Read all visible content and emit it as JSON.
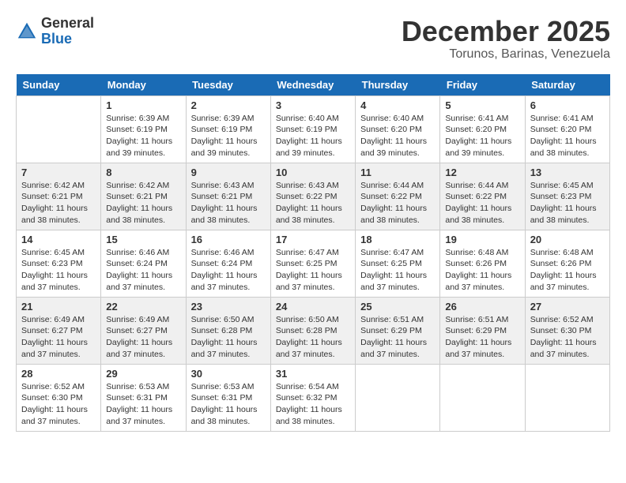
{
  "logo": {
    "general": "General",
    "blue": "Blue"
  },
  "title": {
    "month": "December 2025",
    "location": "Torunos, Barinas, Venezuela"
  },
  "days_header": [
    "Sunday",
    "Monday",
    "Tuesday",
    "Wednesday",
    "Thursday",
    "Friday",
    "Saturday"
  ],
  "weeks": [
    [
      {
        "day": "",
        "info": ""
      },
      {
        "day": "1",
        "info": "Sunrise: 6:39 AM\nSunset: 6:19 PM\nDaylight: 11 hours\nand 39 minutes."
      },
      {
        "day": "2",
        "info": "Sunrise: 6:39 AM\nSunset: 6:19 PM\nDaylight: 11 hours\nand 39 minutes."
      },
      {
        "day": "3",
        "info": "Sunrise: 6:40 AM\nSunset: 6:19 PM\nDaylight: 11 hours\nand 39 minutes."
      },
      {
        "day": "4",
        "info": "Sunrise: 6:40 AM\nSunset: 6:20 PM\nDaylight: 11 hours\nand 39 minutes."
      },
      {
        "day": "5",
        "info": "Sunrise: 6:41 AM\nSunset: 6:20 PM\nDaylight: 11 hours\nand 39 minutes."
      },
      {
        "day": "6",
        "info": "Sunrise: 6:41 AM\nSunset: 6:20 PM\nDaylight: 11 hours\nand 38 minutes."
      }
    ],
    [
      {
        "day": "7",
        "info": "Sunrise: 6:42 AM\nSunset: 6:21 PM\nDaylight: 11 hours\nand 38 minutes."
      },
      {
        "day": "8",
        "info": "Sunrise: 6:42 AM\nSunset: 6:21 PM\nDaylight: 11 hours\nand 38 minutes."
      },
      {
        "day": "9",
        "info": "Sunrise: 6:43 AM\nSunset: 6:21 PM\nDaylight: 11 hours\nand 38 minutes."
      },
      {
        "day": "10",
        "info": "Sunrise: 6:43 AM\nSunset: 6:22 PM\nDaylight: 11 hours\nand 38 minutes."
      },
      {
        "day": "11",
        "info": "Sunrise: 6:44 AM\nSunset: 6:22 PM\nDaylight: 11 hours\nand 38 minutes."
      },
      {
        "day": "12",
        "info": "Sunrise: 6:44 AM\nSunset: 6:22 PM\nDaylight: 11 hours\nand 38 minutes."
      },
      {
        "day": "13",
        "info": "Sunrise: 6:45 AM\nSunset: 6:23 PM\nDaylight: 11 hours\nand 38 minutes."
      }
    ],
    [
      {
        "day": "14",
        "info": "Sunrise: 6:45 AM\nSunset: 6:23 PM\nDaylight: 11 hours\nand 37 minutes."
      },
      {
        "day": "15",
        "info": "Sunrise: 6:46 AM\nSunset: 6:24 PM\nDaylight: 11 hours\nand 37 minutes."
      },
      {
        "day": "16",
        "info": "Sunrise: 6:46 AM\nSunset: 6:24 PM\nDaylight: 11 hours\nand 37 minutes."
      },
      {
        "day": "17",
        "info": "Sunrise: 6:47 AM\nSunset: 6:25 PM\nDaylight: 11 hours\nand 37 minutes."
      },
      {
        "day": "18",
        "info": "Sunrise: 6:47 AM\nSunset: 6:25 PM\nDaylight: 11 hours\nand 37 minutes."
      },
      {
        "day": "19",
        "info": "Sunrise: 6:48 AM\nSunset: 6:26 PM\nDaylight: 11 hours\nand 37 minutes."
      },
      {
        "day": "20",
        "info": "Sunrise: 6:48 AM\nSunset: 6:26 PM\nDaylight: 11 hours\nand 37 minutes."
      }
    ],
    [
      {
        "day": "21",
        "info": "Sunrise: 6:49 AM\nSunset: 6:27 PM\nDaylight: 11 hours\nand 37 minutes."
      },
      {
        "day": "22",
        "info": "Sunrise: 6:49 AM\nSunset: 6:27 PM\nDaylight: 11 hours\nand 37 minutes."
      },
      {
        "day": "23",
        "info": "Sunrise: 6:50 AM\nSunset: 6:28 PM\nDaylight: 11 hours\nand 37 minutes."
      },
      {
        "day": "24",
        "info": "Sunrise: 6:50 AM\nSunset: 6:28 PM\nDaylight: 11 hours\nand 37 minutes."
      },
      {
        "day": "25",
        "info": "Sunrise: 6:51 AM\nSunset: 6:29 PM\nDaylight: 11 hours\nand 37 minutes."
      },
      {
        "day": "26",
        "info": "Sunrise: 6:51 AM\nSunset: 6:29 PM\nDaylight: 11 hours\nand 37 minutes."
      },
      {
        "day": "27",
        "info": "Sunrise: 6:52 AM\nSunset: 6:30 PM\nDaylight: 11 hours\nand 37 minutes."
      }
    ],
    [
      {
        "day": "28",
        "info": "Sunrise: 6:52 AM\nSunset: 6:30 PM\nDaylight: 11 hours\nand 37 minutes."
      },
      {
        "day": "29",
        "info": "Sunrise: 6:53 AM\nSunset: 6:31 PM\nDaylight: 11 hours\nand 37 minutes."
      },
      {
        "day": "30",
        "info": "Sunrise: 6:53 AM\nSunset: 6:31 PM\nDaylight: 11 hours\nand 38 minutes."
      },
      {
        "day": "31",
        "info": "Sunrise: 6:54 AM\nSunset: 6:32 PM\nDaylight: 11 hours\nand 38 minutes."
      },
      {
        "day": "",
        "info": ""
      },
      {
        "day": "",
        "info": ""
      },
      {
        "day": "",
        "info": ""
      }
    ]
  ]
}
